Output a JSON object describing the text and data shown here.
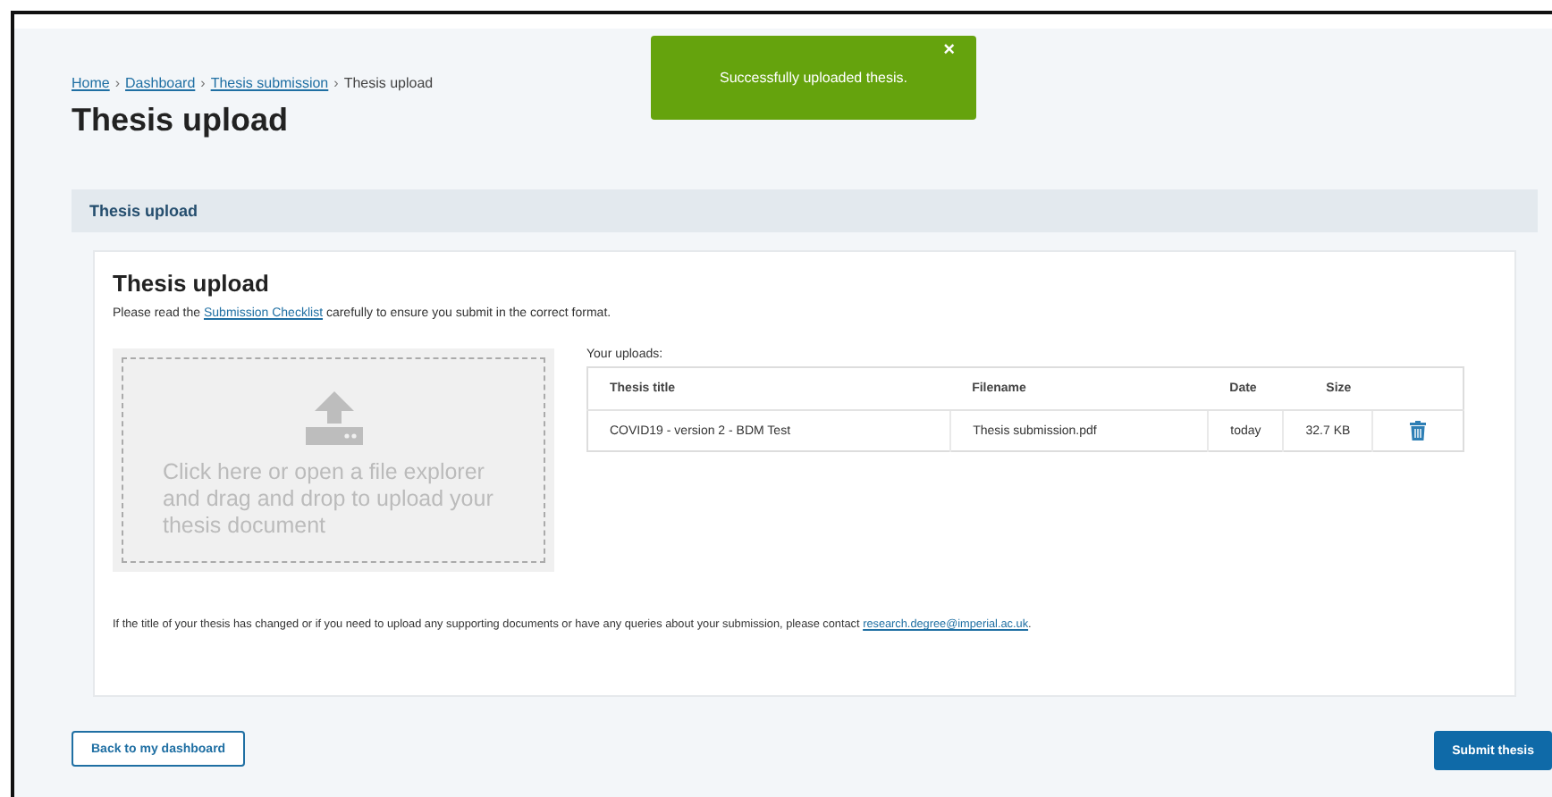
{
  "breadcrumb": [
    {
      "label": "Home",
      "link": true
    },
    {
      "label": "Dashboard",
      "link": true
    },
    {
      "label": "Thesis submission",
      "link": true
    },
    {
      "label": "Thesis upload",
      "link": false
    }
  ],
  "breadcrumb_separator": "›",
  "page_title": "Thesis upload",
  "toast": {
    "message": "Successfully uploaded thesis.",
    "close": "×"
  },
  "panel": {
    "header": "Thesis upload",
    "title": "Thesis upload",
    "intro": {
      "before": "Please read the ",
      "link": "Submission Checklist",
      "after": " carefully to ensure you submit in the correct format."
    },
    "dropzone": {
      "text": "Click here or open a file explorer and drag and drop to upload your thesis document"
    },
    "uploads_label": "Your uploads:",
    "table": {
      "columns": [
        "Thesis title",
        "Filename",
        "Date",
        "Size"
      ],
      "rows": [
        {
          "title": "COVID19 - version 2 - BDM Test",
          "filename": "Thesis submission.pdf",
          "date": "today",
          "size": "32.7 KB"
        }
      ]
    },
    "contact": {
      "before": "If the title of your thesis has changed or if you need to upload any supporting documents or have any queries about your submission, please contact ",
      "link": "research.degree@imperial.ac.uk",
      "after": "."
    }
  },
  "buttons": {
    "back": "Back to my dashboard",
    "submit": "Submit thesis"
  }
}
